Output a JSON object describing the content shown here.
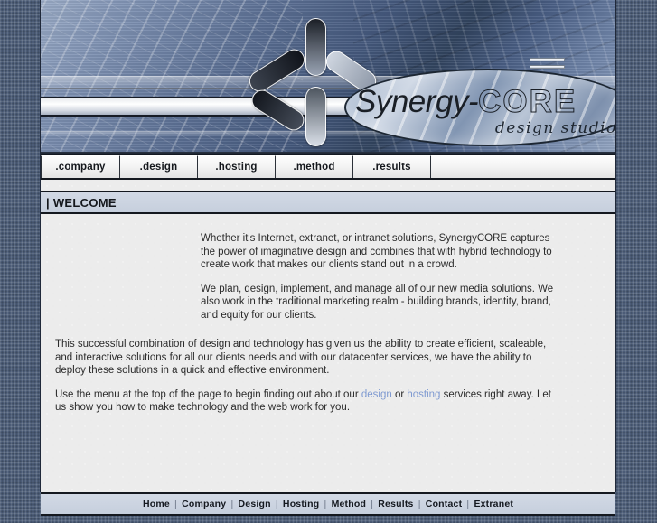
{
  "site": {
    "logo_name_part1": "Synergy-",
    "logo_name_part2": "CORE",
    "logo_tagline": "design studios",
    "logo_mark": "starburst-icon",
    "decor_mark": "double-dash-icon"
  },
  "nav": {
    "tabs": [
      {
        "label": ".company"
      },
      {
        "label": ".design"
      },
      {
        "label": ".hosting"
      },
      {
        "label": ".method"
      },
      {
        "label": ".results"
      }
    ]
  },
  "section": {
    "heading_prefix": "|",
    "heading": "WELCOME"
  },
  "main": {
    "indented_paragraphs": [
      "Whether it's Internet, extranet, or intranet solutions, SynergyCORE captures the power of imaginative design and combines that with hybrid technology to create work that makes our clients stand out in a crowd.",
      "We plan, design, implement, and manage all of our new media solutions. We also work in the traditional marketing realm - building brands, identity, brand, and equity for our clients."
    ],
    "full_paragraph": "This successful combination of design and technology has given us the ability to create efficient, scaleable, and interactive solutions for all our clients needs and with our datacenter services, we have the ability to deploy these solutions in a quick and effective environment.",
    "closing": {
      "before_link1": "Use the menu at the top of the page to begin finding out about our ",
      "link1": "design",
      "between_links": " or ",
      "link2": "hosting",
      "after_link2": " services right away. Let us show you how to make technology and the web work for you."
    }
  },
  "footer": {
    "separator": "|",
    "links": [
      {
        "label": "Home"
      },
      {
        "label": "Company"
      },
      {
        "label": "Design"
      },
      {
        "label": "Hosting"
      },
      {
        "label": "Method"
      },
      {
        "label": "Results"
      },
      {
        "label": "Contact"
      },
      {
        "label": "Extranet"
      }
    ]
  },
  "colors": {
    "page_background": "#4c5c77",
    "content_background": "#ececec",
    "bar_background": "#ccd5e2",
    "border_dark": "#14181f",
    "link": "#7f9ad1",
    "text": "#2b2b2b"
  }
}
